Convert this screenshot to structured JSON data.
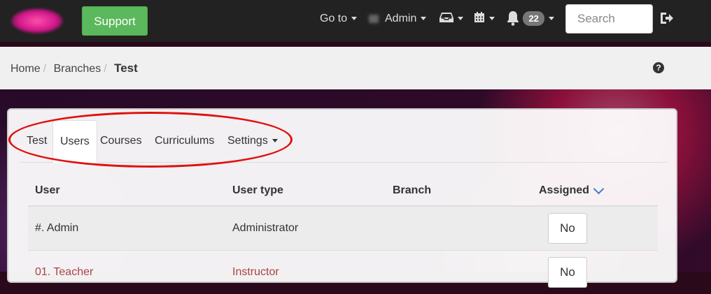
{
  "navbar": {
    "support_label": "Support",
    "goto_label": "Go to",
    "user_label": "Admin",
    "notifications_count": "22",
    "search_placeholder": "Search"
  },
  "breadcrumb": {
    "items": [
      "Home",
      "Branches"
    ],
    "current": "Test"
  },
  "tabs": [
    {
      "label": "Test"
    },
    {
      "label": "Users",
      "active": true
    },
    {
      "label": "Courses"
    },
    {
      "label": "Curriculums"
    },
    {
      "label": "Settings"
    }
  ],
  "table": {
    "headers": {
      "user": "User",
      "user_type": "User type",
      "branch": "Branch",
      "assigned": "Assigned"
    },
    "rows": [
      {
        "user": "#. Admin",
        "user_type": "Administrator",
        "branch": "",
        "assigned": "No"
      },
      {
        "user": "01. Teacher",
        "user_type": "Instructor",
        "branch": "",
        "assigned": "No"
      }
    ]
  },
  "colors": {
    "support_button": "#5cb85c",
    "annotation_ellipse": "#e01010",
    "sort_icon": "#3a7bd5"
  }
}
